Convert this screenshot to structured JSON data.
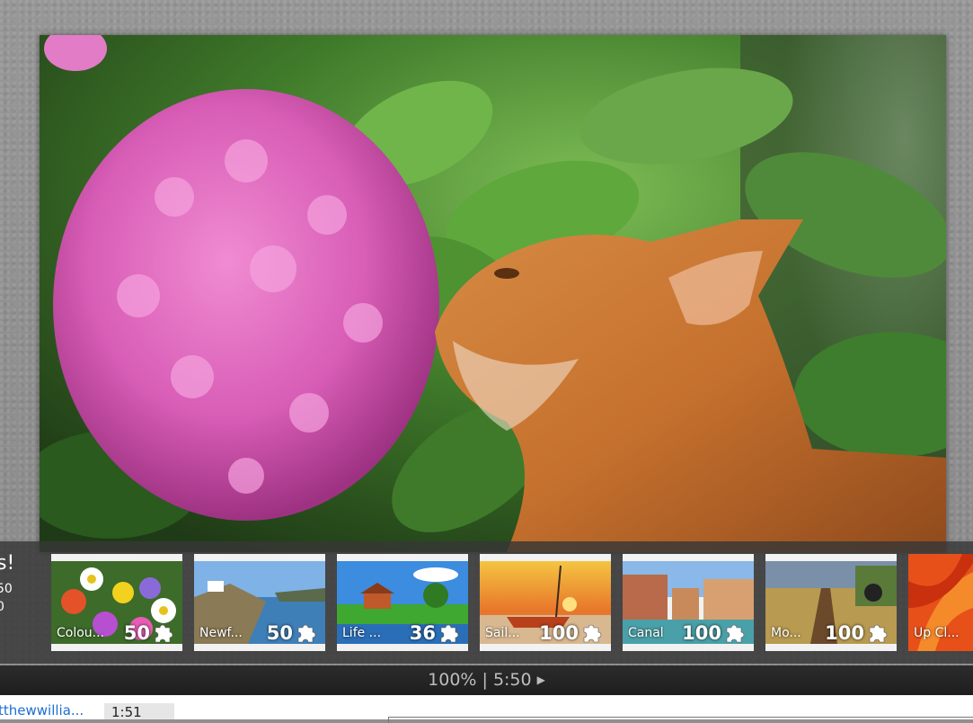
{
  "strip_text": {
    "heading": "s!",
    "line1": "50",
    "line2": "0"
  },
  "thumbnails": [
    {
      "label": "Colou...",
      "count": "50"
    },
    {
      "label": "Newf...",
      "count": "50"
    },
    {
      "label": "Life ...",
      "count": "36"
    },
    {
      "label": "Sail...",
      "count": "100"
    },
    {
      "label": "Canal",
      "count": "100"
    },
    {
      "label": "Mo...",
      "count": "100"
    },
    {
      "label": "Up Cl...",
      "count": ""
    }
  ],
  "status": {
    "text": "100% | 5:50",
    "play_icon": "play-icon"
  },
  "footer": {
    "username": "tthewwillia...",
    "time": "1:51"
  },
  "icons": {
    "puzzle": "puzzle-piece-icon"
  }
}
